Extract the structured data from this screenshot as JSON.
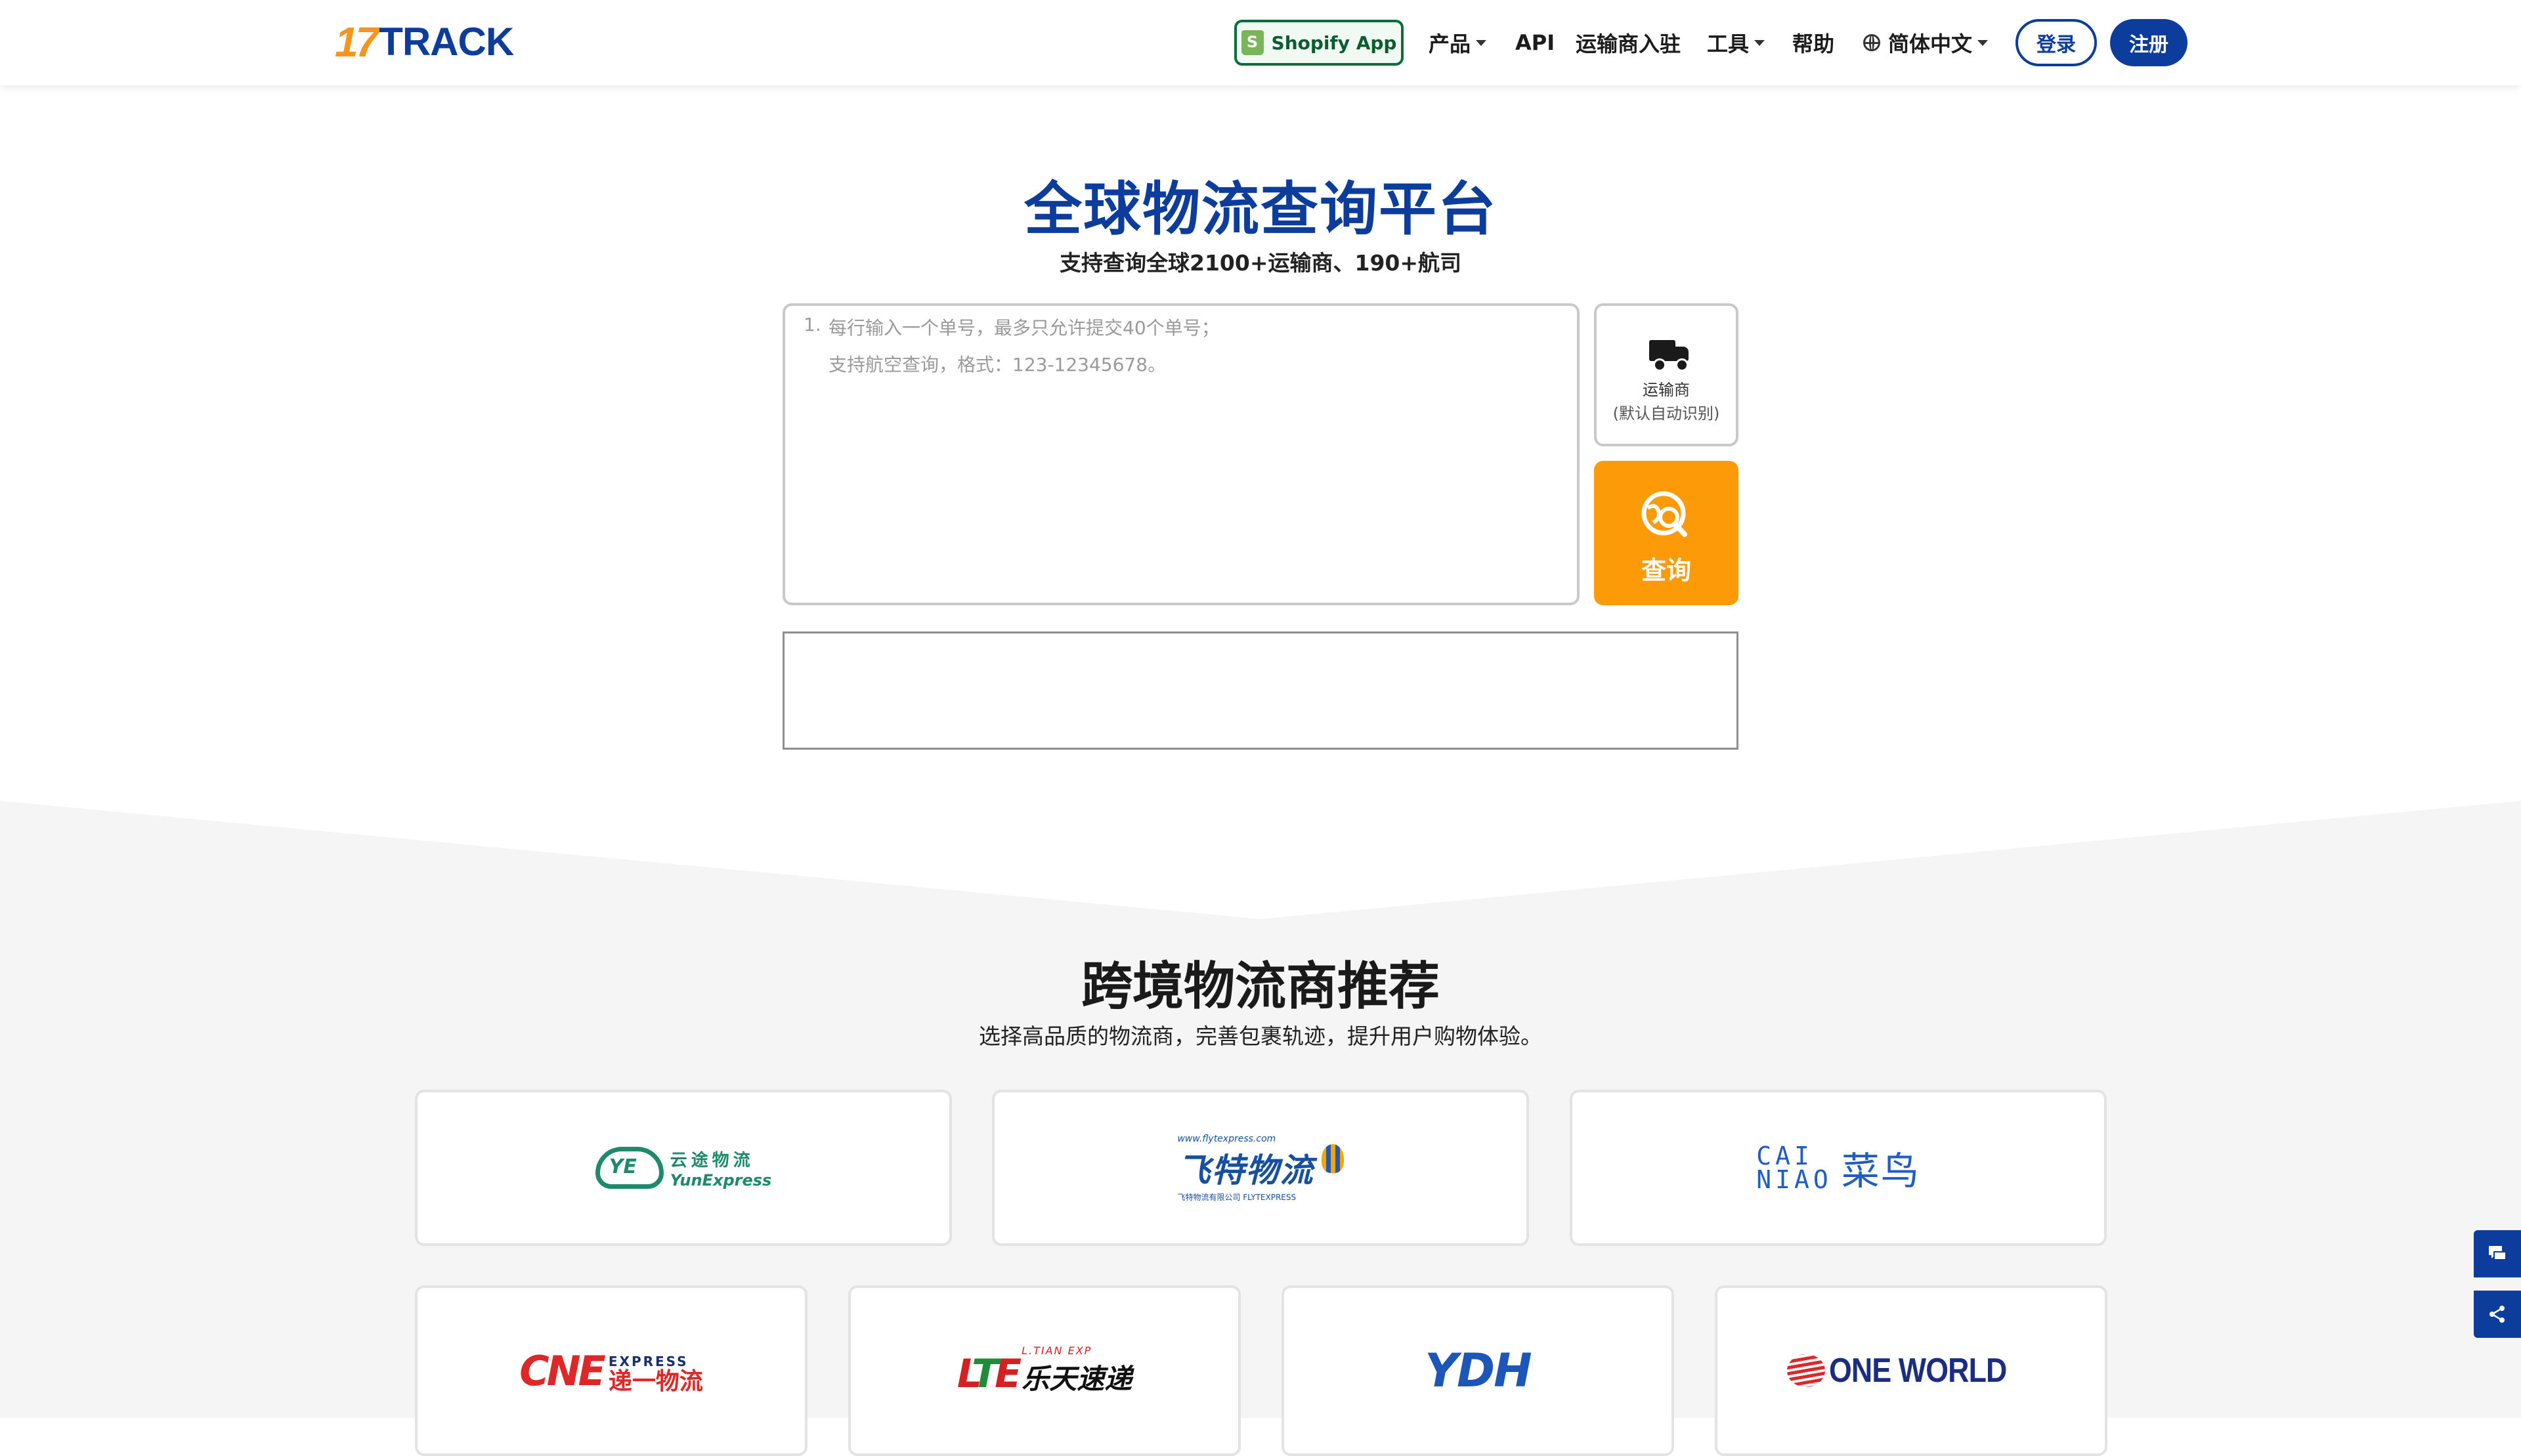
{
  "header": {
    "logo_num": "17",
    "logo_text": "TRACK",
    "shopify_label": "Shopify App",
    "nav": {
      "products": "产品",
      "api": "API",
      "carrier_join": "运输商入驻",
      "tools": "工具",
      "help": "帮助",
      "language": "简体中文"
    },
    "login": "登录",
    "register": "注册"
  },
  "hero": {
    "title": "全球物流查询平台",
    "subtitle": "支持查询全球2100+运输商、190+航司",
    "input_line_no": "1.",
    "placeholder_line1": "每行输入一个单号，最多只允许提交40个单号；",
    "placeholder_line2": "支持航空查询，格式：123-12345678。",
    "carrier_label": "运输商",
    "carrier_sub": "(默认自动识别)",
    "search_label": "查询"
  },
  "recommend": {
    "title": "跨境物流商推荐",
    "subtitle": "选择高品质的物流商，完善包裹轨迹，提升用户购物体验。",
    "carriers": {
      "yunexpress_cn": "云途物流",
      "yunexpress_en": "YunExpress",
      "flyt_url": "www.flytexpress.com",
      "flyt_cn": "飞特物流",
      "flyt_sub": "飞特物流有限公司 FLYTEXPRESS",
      "cainiao_en_1": "CAI",
      "cainiao_en_2": "NIAO",
      "cainiao_cn": "菜鸟",
      "cne_a": "CNE",
      "cne_b": "EXPRESS",
      "cne_c": "递一物流",
      "lt_b": "L.TIAN EXP",
      "lt_c": "乐天速递",
      "ydh": "YDH",
      "oneworld": "ONE WORLD"
    }
  },
  "colors": {
    "brand_blue": "#0c3c9c",
    "brand_orange": "#fd9a08",
    "shopify_green": "#0b6e3a"
  },
  "icons": [
    "shopify-bag-icon",
    "globe-icon",
    "truck-icon",
    "search-globe-icon",
    "chat-icon",
    "share-icon"
  ]
}
